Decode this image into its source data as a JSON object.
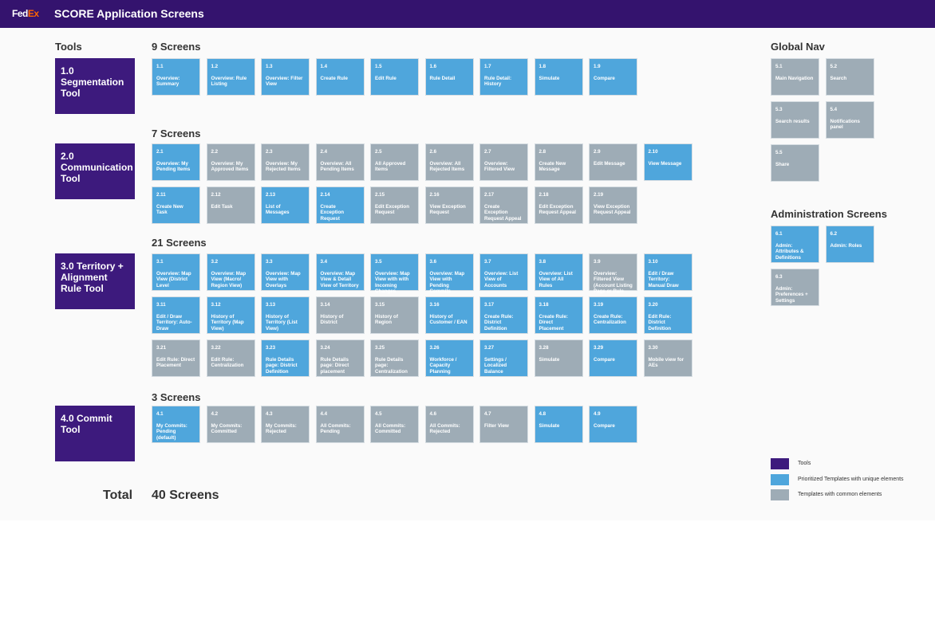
{
  "header": {
    "logo": "FedEx",
    "title": "SCORE Application Screens"
  },
  "colors": {
    "header": "#34136e",
    "tool": "#3d1a7d",
    "prioritized": "#4fa6dc",
    "common": "#9eacb6"
  },
  "tools_heading": "Tools",
  "sections": [
    {
      "tool": "1.0 Segmentation Tool",
      "count": "9 Screens",
      "tiles": [
        [
          "1.1",
          "Overview: Summary",
          "blue"
        ],
        [
          "1.2",
          "Overview: Rule Listing",
          "blue"
        ],
        [
          "1.3",
          "Overview: Filter View",
          "blue"
        ],
        [
          "1.4",
          "Create Rule",
          "blue"
        ],
        [
          "1.5",
          "Edit Rule",
          "blue"
        ],
        [
          "1.6",
          "Rule Detail",
          "blue"
        ],
        [
          "1.7",
          "Rule Detail: History",
          "blue"
        ],
        [
          "1.8",
          "Simulate",
          "blue"
        ],
        [
          "1.9",
          "Compare",
          "blue"
        ]
      ]
    },
    {
      "tool": "2.0 Communication Tool",
      "count": "7 Screens",
      "tiles": [
        [
          "2.1",
          "Overview: My Pending Items",
          "blue"
        ],
        [
          "2.2",
          "Overview: My Approved Items",
          "gray"
        ],
        [
          "2.3",
          "Overview: My Rejected Items",
          "gray"
        ],
        [
          "2.4",
          "Overview: All Pending Items",
          "gray"
        ],
        [
          "2.5",
          "All Approved Items",
          "gray"
        ],
        [
          "2.6",
          "Overview: All Rejected Items",
          "gray"
        ],
        [
          "2.7",
          "Overview: Filtered View",
          "gray"
        ],
        [
          "2.8",
          "Create New Message",
          "gray"
        ],
        [
          "2.9",
          "Edit Message",
          "gray"
        ],
        [
          "2.10",
          "View Message",
          "blue"
        ],
        [
          "2.11",
          "Create New Task",
          "blue"
        ],
        [
          "2.12",
          "Edit Task",
          "gray"
        ],
        [
          "2.13",
          "List of Messages",
          "blue"
        ],
        [
          "2.14",
          "Create Exception Request",
          "blue"
        ],
        [
          "2.15",
          "Edit Exception Request",
          "gray"
        ],
        [
          "2.16",
          "View Exception Request",
          "gray"
        ],
        [
          "2.17",
          "Create Exception Request Appeal",
          "gray"
        ],
        [
          "2.18",
          "Edit Exception Request Appeal",
          "gray"
        ],
        [
          "2.19",
          "View Exception Request Appeal",
          "gray"
        ]
      ]
    },
    {
      "tool": "3.0 Territory + Alignment Rule Tool",
      "count": "21 Screens",
      "tiles": [
        [
          "3.1",
          "Overview: Map View (District Level",
          "blue"
        ],
        [
          "3.2",
          "Overview: Map View (Macro/ Region View)",
          "blue"
        ],
        [
          "3.3",
          "Overview: Map View with Overlays",
          "blue"
        ],
        [
          "3.4",
          "Overview: Map View & Detail View of Territory",
          "blue"
        ],
        [
          "3.5",
          "Overview: Map View with with Incoming Changes",
          "blue"
        ],
        [
          "3.6",
          "Overview: Map View with Pending Commits",
          "blue"
        ],
        [
          "3.7",
          "Overview: List View of Accounts",
          "blue"
        ],
        [
          "3.8",
          "Overview: List View of All Rules",
          "blue"
        ],
        [
          "3.9",
          "Overview: Filtered View (Account Listing Page or Rule",
          "gray"
        ],
        [
          "3.10",
          "Edit / Draw Territory: Manual Draw",
          "blue"
        ],
        [
          "3.11",
          "Edit / Draw Territory: Auto-Draw",
          "blue"
        ],
        [
          "3.12",
          "History of Territory (Map View)",
          "blue"
        ],
        [
          "3.13",
          "History of Territory (List View)",
          "blue"
        ],
        [
          "3.14",
          "History of District",
          "gray"
        ],
        [
          "3.15",
          "History of Region",
          "gray"
        ],
        [
          "3.16",
          "History of Customer / EAN",
          "blue"
        ],
        [
          "3.17",
          "Create Rule: District Definition",
          "blue"
        ],
        [
          "3.18",
          "Create Rule: Direct Placement",
          "blue"
        ],
        [
          "3.19",
          "Create Rule: Centralization",
          "blue"
        ],
        [
          "3.20",
          "Edit Rule: District Definition",
          "blue"
        ],
        [
          "3.21",
          "Edit Rule: Direct Placement",
          "gray"
        ],
        [
          "3.22",
          "Edit Rule: Centralization",
          "gray"
        ],
        [
          "3.23",
          "Rule Details page: District Definition",
          "blue"
        ],
        [
          "3.24",
          "Rule Details page: Direct placement",
          "gray"
        ],
        [
          "3.25",
          "Rule Details page: Centralization",
          "gray"
        ],
        [
          "3.26",
          "Workforce / Capacity Planning",
          "blue"
        ],
        [
          "3.27",
          "Settings / Localized Balance",
          "blue"
        ],
        [
          "3.28",
          "Simulate",
          "gray"
        ],
        [
          "3.29",
          "Compare",
          "blue"
        ],
        [
          "3.30",
          "Mobile view for AEs",
          "gray"
        ]
      ]
    },
    {
      "tool": "4.0 Commit Tool",
      "count": "3 Screens",
      "tiles": [
        [
          "4.1",
          "My Commits: Pending (default)",
          "blue"
        ],
        [
          "4.2",
          "My Commits: Committed",
          "gray"
        ],
        [
          "4.3",
          "My Commits: Rejected",
          "gray"
        ],
        [
          "4.4",
          "All Commits: Pending",
          "gray"
        ],
        [
          "4.5",
          "All Commits: Committed",
          "gray"
        ],
        [
          "4.6",
          "All Commits: Rejected",
          "gray"
        ],
        [
          "4.7",
          "Filter View",
          "gray"
        ],
        [
          "4.8",
          "Simulate",
          "blue"
        ],
        [
          "4.9",
          "Compare",
          "blue"
        ]
      ]
    }
  ],
  "global_nav": {
    "heading": "Global Nav",
    "tiles": [
      [
        "5.1",
        "Main Navigation",
        "gray"
      ],
      [
        "5.2",
        "Search",
        "gray"
      ],
      [
        "5.3",
        "Search results",
        "gray"
      ],
      [
        "5.4",
        "Notifications panel",
        "gray"
      ],
      [
        "5.5",
        "Share",
        "gray"
      ]
    ]
  },
  "admin": {
    "heading": "Administration Screens",
    "tiles": [
      [
        "6.1",
        "Admin: Attributes & Definitions",
        "blue"
      ],
      [
        "6.2",
        "Admin: Roles",
        "blue"
      ],
      [
        "6.3",
        "Admin: Preferences + Settings",
        "gray"
      ]
    ]
  },
  "legend": [
    {
      "label": "Tools",
      "color": "#3d1a7d"
    },
    {
      "label": "Prioritized Templates with unique elements",
      "color": "#4fa6dc"
    },
    {
      "label": "Templates with common elements",
      "color": "#9eacb6"
    }
  ],
  "total": {
    "label": "Total",
    "value": "40 Screens"
  }
}
